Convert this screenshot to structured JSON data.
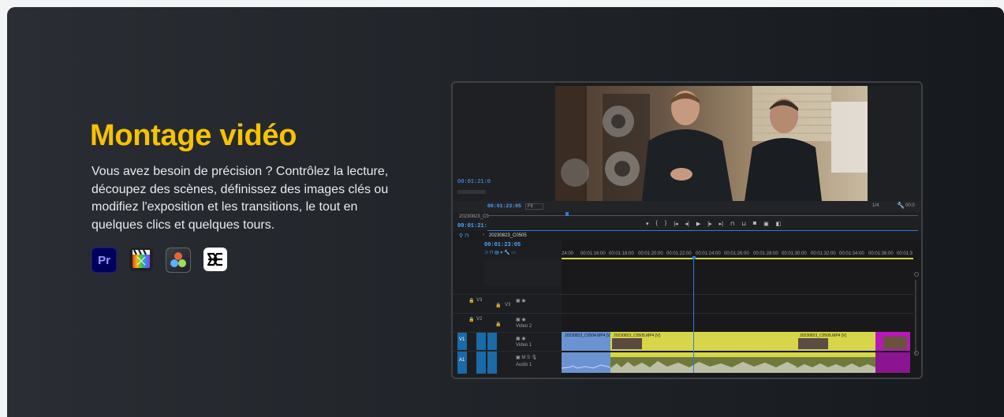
{
  "section": {
    "title": "Montage vidéo",
    "description": "Vous avez besoin de précision ? Contrôlez la lecture, découpez des scènes, définissez des images clés ou modifiez l'exposition et les transitions, le tout en quelques clics et quelques tours."
  },
  "apps": [
    {
      "name": "Adobe Premiere Pro",
      "icon": "premiere-pro-icon",
      "text": "Pr"
    },
    {
      "name": "Final Cut Pro",
      "icon": "final-cut-pro-icon"
    },
    {
      "name": "DaVinci Resolve",
      "icon": "davinci-resolve-icon"
    },
    {
      "name": "CapCut",
      "icon": "capcut-icon"
    }
  ],
  "editor": {
    "source_timecode": "00:01:21:0",
    "program_timecode": "00:01:23:05",
    "fit": "Fit",
    "zoom": "1/4",
    "end_timecode": "00:0",
    "sequence_name": "20230823_C0",
    "sequence_tab": "20230823_C0505",
    "timeline_timecode_left": "00:01:21:",
    "timeline_timecode": "00:01:23:05",
    "ruler_ticks": [
      "24:00",
      "00:01:16:00",
      "00:01:18:00",
      "00:01:20:00",
      "00:01:22:00",
      "00:01:24:00",
      "00:01:26:00",
      "00:01:28:00",
      "00:01:30:00",
      "00:01:32:00",
      "00:01:34:00",
      "00:01:36:00",
      "00:01:3"
    ],
    "tracks": [
      {
        "id": "V3",
        "label": ""
      },
      {
        "id": "V2",
        "label": "Video 2"
      },
      {
        "id": "V1",
        "label": "Video 1"
      },
      {
        "id": "A1",
        "label": "Audio 1"
      }
    ],
    "clips": [
      "20230823_C0504.MP4 [V]",
      "20230823_C0505.MP4 [V]",
      "20230823_C0506.MP4 [V]"
    ],
    "colors": {
      "accent": "#f7c300",
      "playhead": "#2f7bd8",
      "clip_yellow": "#d7d64a",
      "clip_blue": "#6c93d1",
      "clip_magenta": "#b51ab8"
    }
  }
}
